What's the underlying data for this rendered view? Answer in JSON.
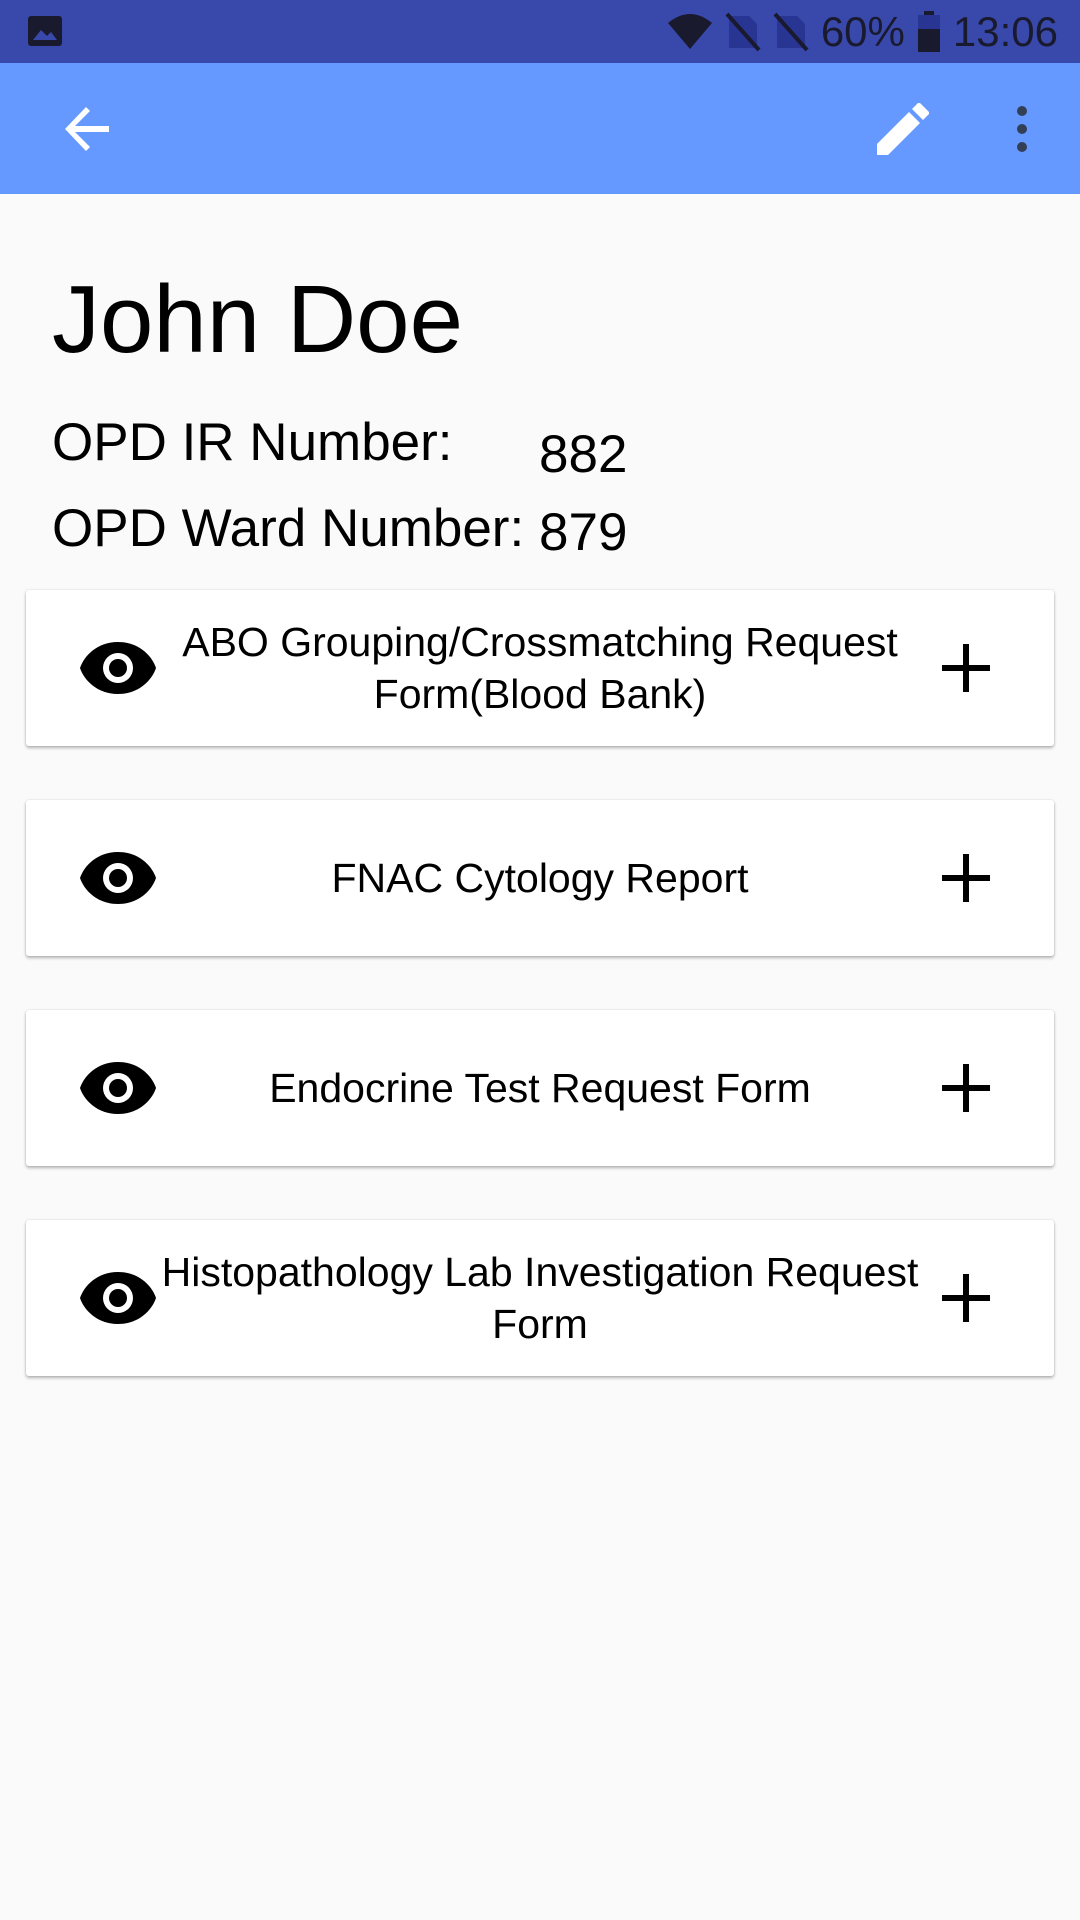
{
  "status_bar": {
    "battery": "60%",
    "time": "13:06",
    "icons": [
      "gallery-icon",
      "wifi-icon",
      "no-sim-icon",
      "no-sim-icon",
      "battery-icon"
    ]
  },
  "app_bar": {
    "color": "#6699ff",
    "icons": [
      "back-arrow-icon",
      "pencil-icon",
      "more-vert-icon"
    ]
  },
  "patient": {
    "name": "John Doe",
    "ir_label": "OPD IR Number:",
    "ir_value": "882",
    "ward_label": "OPD Ward Number:",
    "ward_value": "879"
  },
  "forms": [
    {
      "title": "ABO Grouping/Crossmatching Request Form(Blood Bank)"
    },
    {
      "title": "FNAC Cytology Report"
    },
    {
      "title": "Endocrine Test Request Form"
    },
    {
      "title": "Histopathology Lab Investigation Request Form"
    }
  ]
}
